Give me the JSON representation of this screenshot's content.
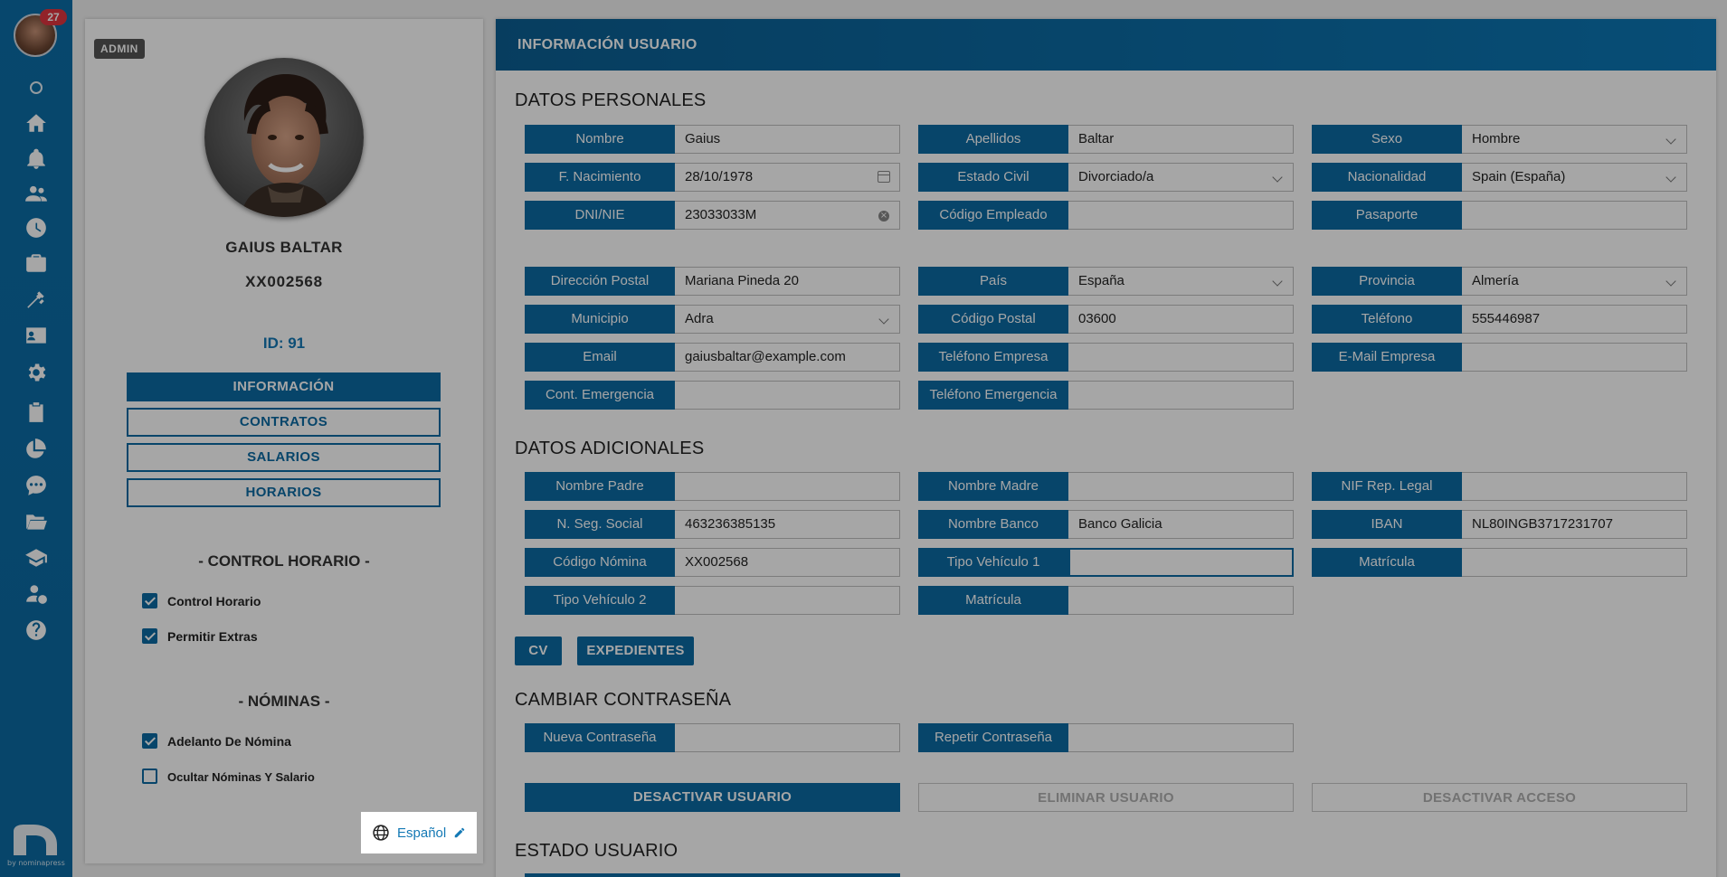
{
  "nav": {
    "badge_count": "27",
    "icons": [
      "status-dot-icon",
      "home-icon",
      "bell-icon",
      "people-icon",
      "clock-icon",
      "briefcase-icon",
      "tools-icon",
      "id-card-icon",
      "gear-icon",
      "clipboard-icon",
      "pie-chart-icon",
      "chat-icon",
      "folder-icon",
      "graduation-cap-icon",
      "user-payroll-icon",
      "help-icon"
    ],
    "footer": "by nominapress"
  },
  "profile": {
    "role_badge": "ADMIN",
    "full_name": "GAIUS BALTAR",
    "employee_code": "XX002568",
    "id_label": "ID: 91",
    "menu": {
      "info": "INFORMACIÓN",
      "contracts": "CONTRATOS",
      "salaries": "SALARIOS",
      "schedules": "HORARIOS"
    },
    "control_section": "- CONTROL HORARIO -",
    "control_items": [
      {
        "label": "Control Horario",
        "checked": true
      },
      {
        "label": "Permitir Extras",
        "checked": true
      }
    ],
    "payroll_section": "- NÓMINAS -",
    "payroll_items": [
      {
        "label": "Adelanto De Nómina",
        "checked": true
      },
      {
        "label": "Ocultar Nóminas Y Salario",
        "checked": false
      }
    ],
    "language": "Español"
  },
  "main": {
    "header": "INFORMACIÓN USUARIO",
    "personal_title": "DATOS PERSONALES",
    "personal": {
      "nombre": {
        "label": "Nombre",
        "value": "Gaius"
      },
      "apellidos": {
        "label": "Apellidos",
        "value": "Baltar"
      },
      "sexo": {
        "label": "Sexo",
        "value": "Hombre"
      },
      "nacimiento": {
        "label": "F. Nacimiento",
        "value": "28/10/1978"
      },
      "estado_civil": {
        "label": "Estado Civil",
        "value": "Divorciado/a"
      },
      "nacionalidad": {
        "label": "Nacionalidad",
        "value": "Spain (España)"
      },
      "dni": {
        "label": "DNI/NIE",
        "value": "23033033M"
      },
      "codigo_empleado": {
        "label": "Código Empleado",
        "value": ""
      },
      "pasaporte": {
        "label": "Pasaporte",
        "value": ""
      },
      "direccion": {
        "label": "Dirección Postal",
        "value": "Mariana Pineda 20"
      },
      "pais": {
        "label": "País",
        "value": "España"
      },
      "provincia": {
        "label": "Provincia",
        "value": "Almería"
      },
      "municipio": {
        "label": "Municipio",
        "value": "Adra"
      },
      "codigo_postal": {
        "label": "Código Postal",
        "value": "03600"
      },
      "telefono": {
        "label": "Teléfono",
        "value": "555446987"
      },
      "email": {
        "label": "Email",
        "value": "gaiusbaltar@example.com"
      },
      "telefono_empresa": {
        "label": "Teléfono Empresa",
        "value": ""
      },
      "email_empresa": {
        "label": "E-Mail Empresa",
        "value": ""
      },
      "cont_emergencia": {
        "label": "Cont. Emergencia",
        "value": ""
      },
      "telefono_emergencia": {
        "label": "Teléfono Emergencia",
        "value": ""
      }
    },
    "additional_title": "DATOS ADICIONALES",
    "additional": {
      "nombre_padre": {
        "label": "Nombre Padre",
        "value": ""
      },
      "nombre_madre": {
        "label": "Nombre Madre",
        "value": ""
      },
      "nif_rep": {
        "label": "NIF Rep. Legal",
        "value": ""
      },
      "seg_social": {
        "label": "N. Seg. Social",
        "value": "463236385135"
      },
      "banco": {
        "label": "Nombre Banco",
        "value": "Banco Galicia"
      },
      "iban": {
        "label": "IBAN",
        "value": "NL80INGB3717231707"
      },
      "codigo_nomina": {
        "label": "Código Nómina",
        "value": "XX002568"
      },
      "tipo_vehiculo_1": {
        "label": "Tipo Vehículo 1",
        "value": ""
      },
      "matricula_1": {
        "label": "Matrícula",
        "value": ""
      },
      "tipo_vehiculo_2": {
        "label": "Tipo Vehículo 2",
        "value": ""
      },
      "matricula_2": {
        "label": "Matrícula",
        "value": ""
      }
    },
    "buttons": {
      "cv": "CV",
      "expedientes": "EXPEDIENTES"
    },
    "password_title": "CAMBIAR CONTRASEÑA",
    "password": {
      "nueva": {
        "label": "Nueva Contraseña",
        "value": ""
      },
      "repetir": {
        "label": "Repetir Contraseña",
        "value": ""
      }
    },
    "actions": {
      "desactivar_usuario": "DESACTIVAR USUARIO",
      "eliminar_usuario": "ELIMINAR USUARIO",
      "desactivar_acceso": "DESACTIVAR ACCESO"
    },
    "status_title": "ESTADO USUARIO"
  },
  "colors": {
    "primary": "#0c6aa3",
    "badge": "#e0353f",
    "link": "#1479b5"
  }
}
